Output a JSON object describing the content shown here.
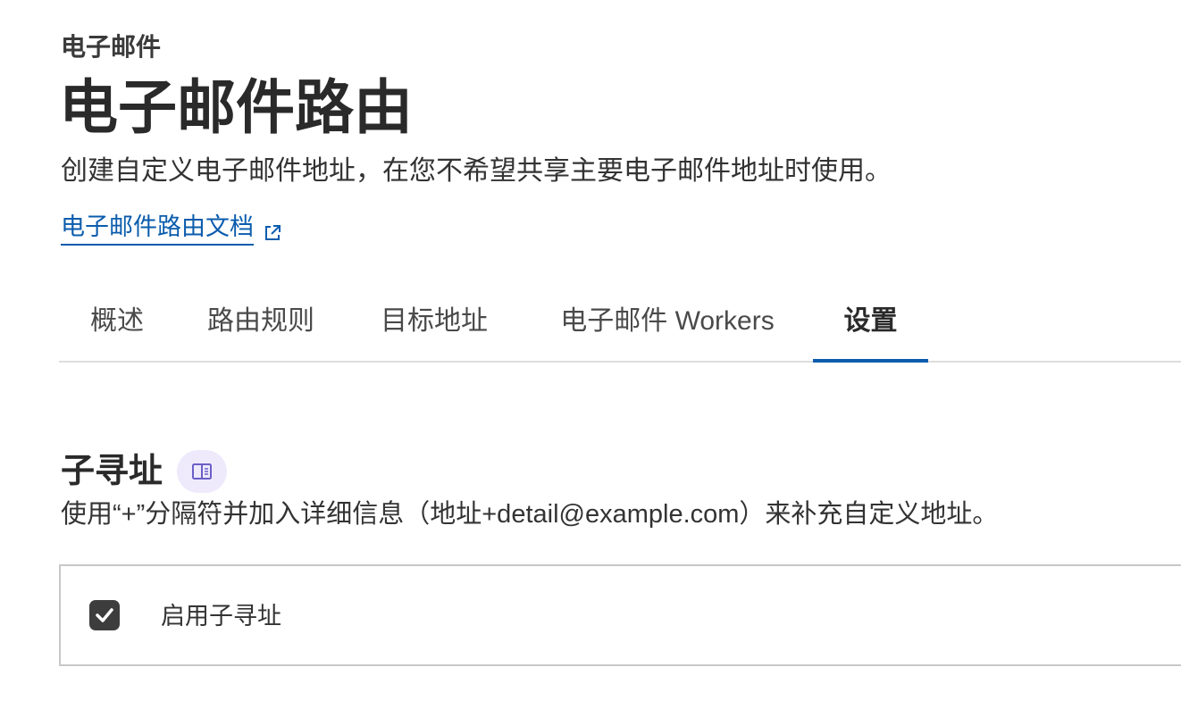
{
  "header": {
    "breadcrumb": "电子邮件",
    "title": "电子邮件路由",
    "description": "创建自定义电子邮件地址，在您不希望共享主要电子邮件地址时使用。",
    "doc_link_label": "电子邮件路由文档",
    "doc_link_icon": "external-link-icon"
  },
  "tabs": [
    {
      "label": "概述",
      "active": false
    },
    {
      "label": "路由规则",
      "active": false
    },
    {
      "label": "目标地址",
      "active": false
    },
    {
      "label": "电子邮件 Workers",
      "active": false
    },
    {
      "label": "设置",
      "active": true
    }
  ],
  "subaddressing": {
    "title": "子寻址",
    "title_icon": "book-icon",
    "description": "使用“+”分隔符并加入详细信息（地址+detail@example.com）来补充自定义地址。",
    "checkbox_label": "启用子寻址",
    "checkbox_checked": true
  },
  "colors": {
    "link": "#0b5cad",
    "active_tab_underline": "#0b5cad",
    "checkbox_fill": "#3d3d3d",
    "badge_background": "#eeeafc",
    "badge_icon": "#6b5fc7"
  }
}
